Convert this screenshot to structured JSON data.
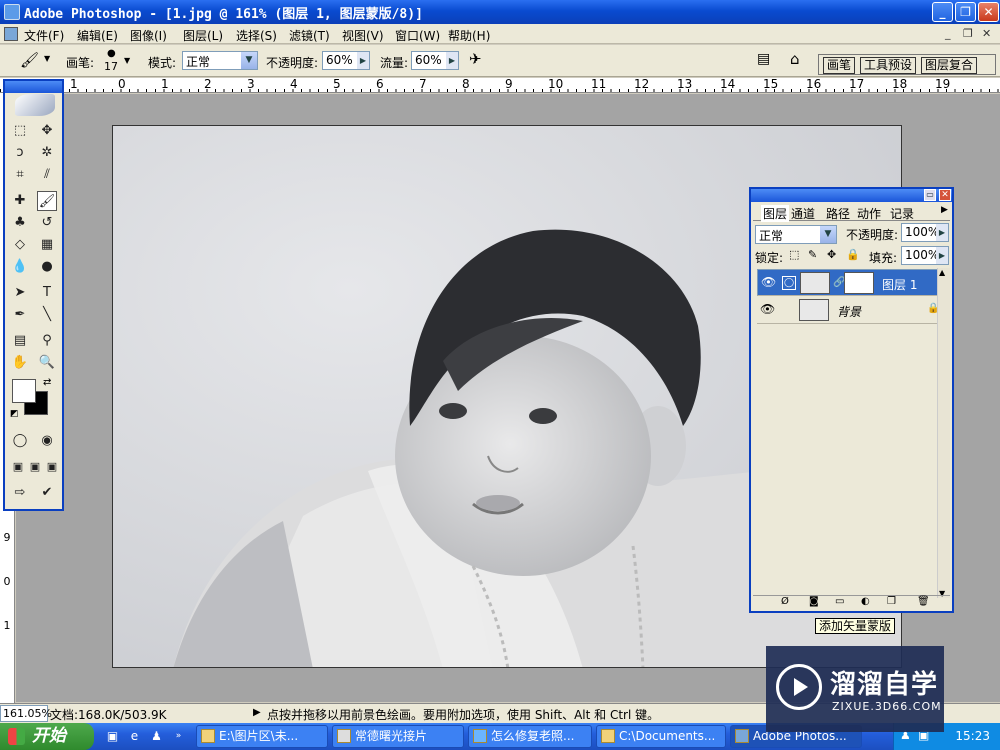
{
  "window": {
    "title": "Adobe Photoshop - [1.jpg @ 161% (图层 1, 图层蒙版/8)]",
    "buttons": {
      "minimize": "_",
      "maximize": "❐",
      "close": "✕"
    }
  },
  "menubar": {
    "items": [
      "文件(F)",
      "编辑(E)",
      "图像(I)",
      "图层(L)",
      "选择(S)",
      "滤镜(T)",
      "视图(V)",
      "窗口(W)",
      "帮助(H)"
    ],
    "doc_controls": [
      "_",
      "❐",
      "✕"
    ]
  },
  "options_bar": {
    "brush_label": "画笔:",
    "brush_size": "17",
    "mode_label": "模式:",
    "mode_value": "正常",
    "opacity_label": "不透明度:",
    "opacity_value": "60%",
    "flow_label": "流量:",
    "flow_value": "60%",
    "palette_well_tabs": [
      "画笔",
      "工具预设",
      "图层复合"
    ]
  },
  "rulers": {
    "horizontal": [
      "1",
      "0",
      "1",
      "2",
      "3",
      "4",
      "5",
      "6",
      "7",
      "8",
      "9",
      "10",
      "11",
      "12",
      "13",
      "14",
      "15",
      "16",
      "17",
      "18",
      "19"
    ],
    "vertical": [
      "9",
      "0",
      "1"
    ]
  },
  "layers_panel": {
    "tabs": [
      "图层",
      "通道",
      "路径",
      "动作",
      "记录"
    ],
    "blend_mode": "正常",
    "opacity_label": "不透明度:",
    "opacity_value": "100%",
    "lock_label": "锁定:",
    "fill_label": "填充:",
    "fill_value": "100%",
    "layers": [
      {
        "name": "图层 1",
        "selected": true,
        "has_mask": true
      },
      {
        "name": "背景",
        "selected": false,
        "locked": true
      }
    ]
  },
  "tooltip": "添加矢量蒙版",
  "status_bar": {
    "zoom": "161.05%",
    "doc_info": "文档:168.0K/503.9K",
    "hint": "点按并拖移以用前景色绘画。要用附加选项，使用 Shift、Alt 和 Ctrl 键。"
  },
  "taskbar": {
    "start_label": "开始",
    "tasks": [
      {
        "label": "E:\\图片区\\未...",
        "active": false
      },
      {
        "label": "常德曙光接片",
        "active": false
      },
      {
        "label": "怎么修复老照...",
        "active": false
      },
      {
        "label": "C:\\Documents...",
        "active": false
      },
      {
        "label": "Adobe Photos...",
        "active": true
      }
    ],
    "clock": "15:23"
  },
  "watermark": {
    "brand": "溜溜自学",
    "site": "ZIXUE.3D66.COM"
  }
}
